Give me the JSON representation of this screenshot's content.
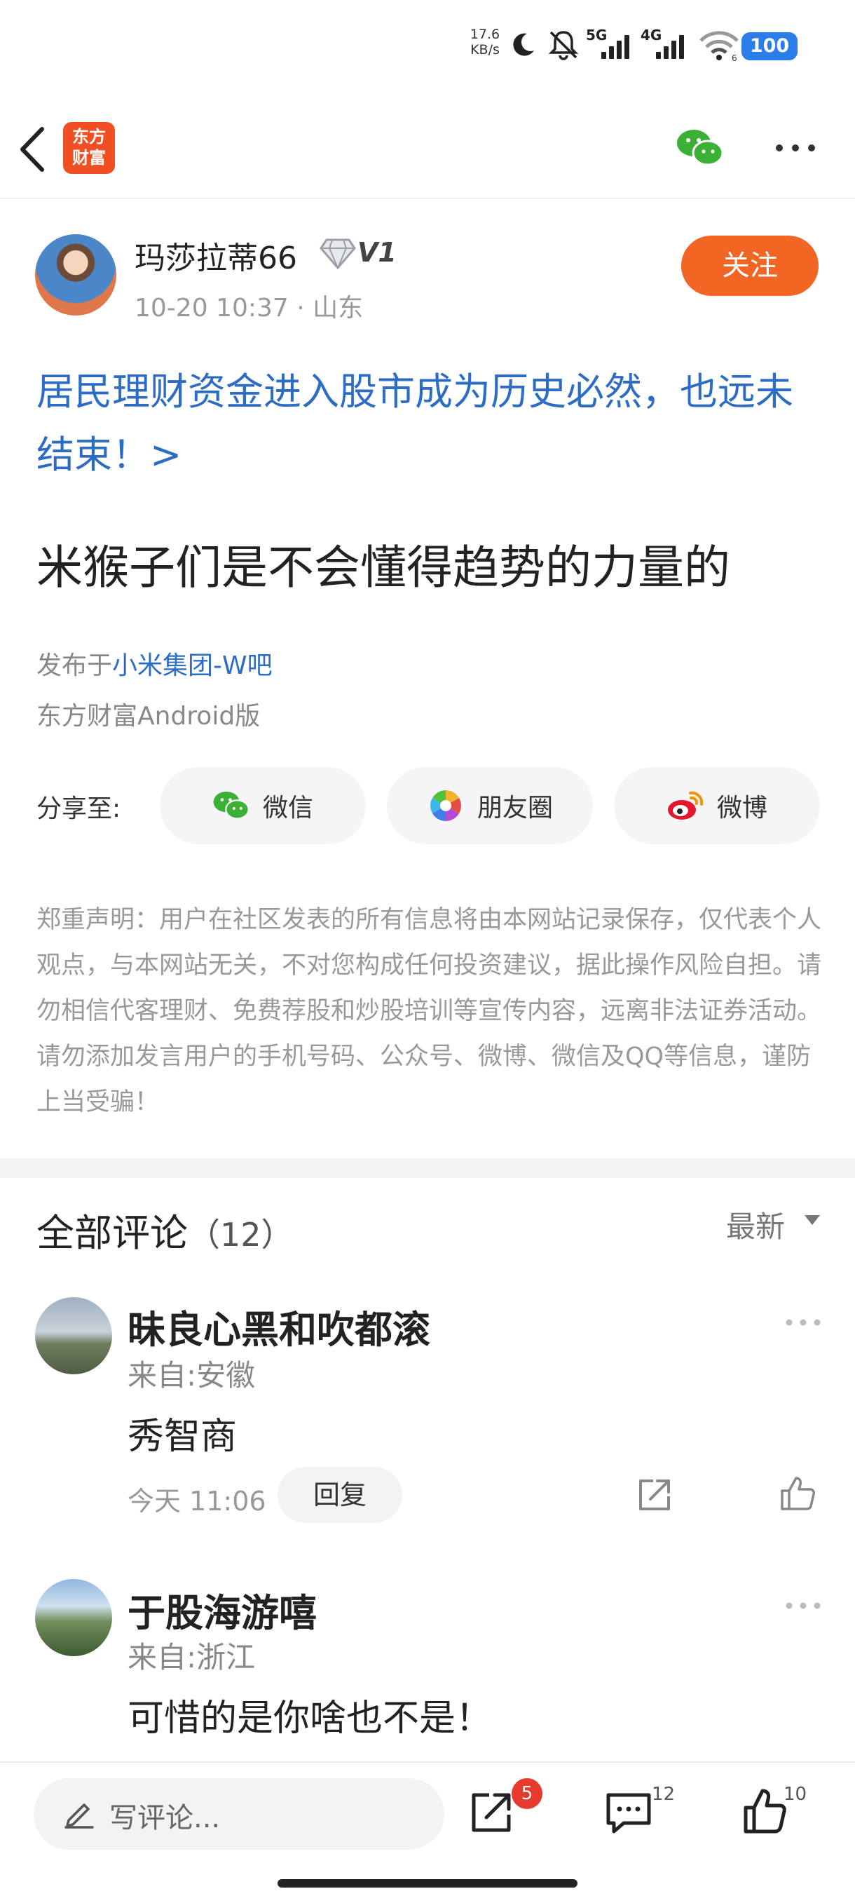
{
  "status_bar": {
    "net_speed_value": "17.6",
    "net_speed_unit": "KB/s",
    "sim1_tag": "5G",
    "sim2_tag": "4G",
    "wifi_sub": "6",
    "battery": "100"
  },
  "nav": {
    "logo_line1": "东方",
    "logo_line2": "财富",
    "icons": [
      "back-icon",
      "wechat-icon",
      "more-icon"
    ]
  },
  "author": {
    "name": "玛莎拉蒂66",
    "level": "V1",
    "meta": "10-20 10:37 · 山东",
    "follow_label": "关注"
  },
  "post": {
    "topic_link": "居民理财资金进入股市成为历史必然，也远未结束！>",
    "body": "米猴子们是不会懂得趋势的力量的",
    "posted_in_prefix": "发布于",
    "posted_in_bar": "小米集团-W吧",
    "client": "东方财富Android版"
  },
  "share": {
    "label": "分享至:",
    "targets": [
      {
        "label": "微信",
        "icon": "wechat-icon"
      },
      {
        "label": "朋友圈",
        "icon": "moments-icon"
      },
      {
        "label": "微博",
        "icon": "weibo-icon"
      }
    ]
  },
  "disclaimer": "郑重声明：用户在社区发表的所有信息将由本网站记录保存，仅代表个人观点，与本网站无关，不对您构成任何投资建议，据此操作风险自担。请勿相信代客理财、免费荐股和炒股培训等宣传内容，远离非法证券活动。请勿添加发言用户的手机号码、公众号、微博、微信及QQ等信息，谨防上当受骗！",
  "comments_section": {
    "title": "全部评论",
    "count": "（12）",
    "sort_label": "最新",
    "items": [
      {
        "name": "昧良心黑和吹都滚",
        "location": "来自:安徽",
        "text": "秀智商",
        "time": "今天 11:06",
        "reply_label": "回复"
      },
      {
        "name": "于股海游嘻",
        "location": "来自:浙江",
        "text": "可惜的是你啥也不是！"
      }
    ]
  },
  "bottom_bar": {
    "input_placeholder": "写评论...",
    "share_badge": "5",
    "comment_count": "12",
    "like_count": "10"
  },
  "colors": {
    "accent_orange": "#f26522",
    "link_blue": "#2d6cc4",
    "badge_red": "#e63a2e",
    "battery_blue": "#2b7de9"
  }
}
